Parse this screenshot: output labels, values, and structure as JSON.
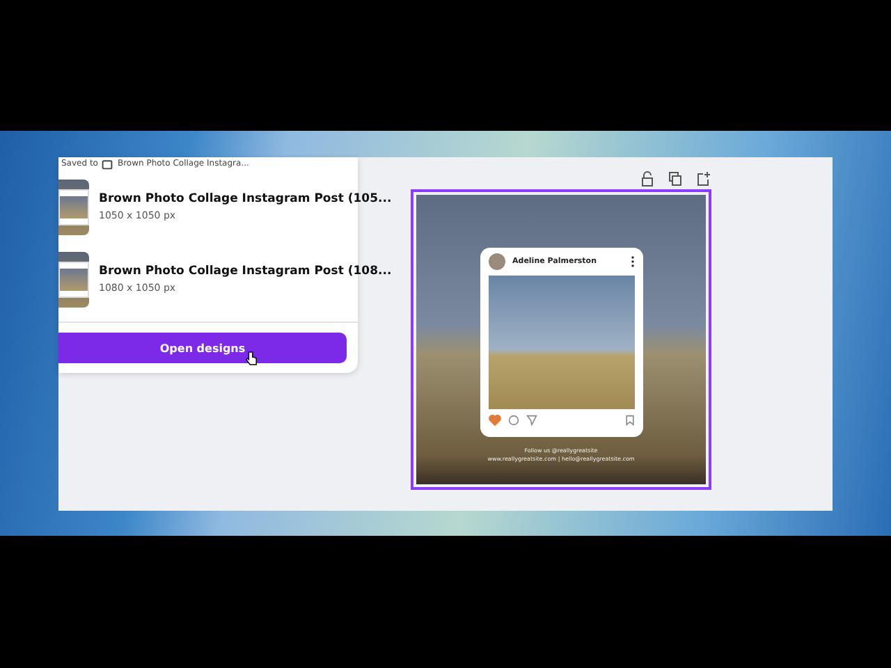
{
  "panel": {
    "saved_to_label": "Saved to",
    "saved_to_folder": "Brown Photo Collage Instagra...",
    "designs": [
      {
        "title": "Brown Photo Collage Instagram Post (105...",
        "size": "1050 x 1050 px"
      },
      {
        "title": "Brown Photo Collage Instagram Post (108...",
        "size": "1080 x 1050 px"
      }
    ],
    "open_button": "Open designs"
  },
  "design": {
    "selected": true,
    "post": {
      "username": "Adeline Palmerston",
      "liked": true
    },
    "footer_lines": [
      "Follow us @reallygreatsite",
      "www.reallygreatsite.com | hello@reallygreatsite.com"
    ]
  }
}
